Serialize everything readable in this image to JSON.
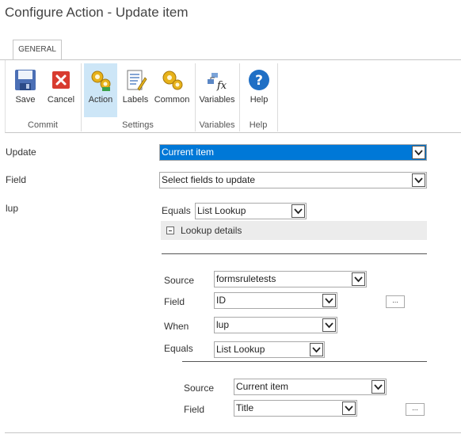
{
  "title": "Configure Action - Update item",
  "ribbon": {
    "tab": "GENERAL",
    "buttons": {
      "save": "Save",
      "cancel": "Cancel",
      "action": "Action",
      "labels": "Labels",
      "common": "Common",
      "variables": "Variables",
      "help": "Help"
    },
    "groups": {
      "commit": "Commit",
      "settings": "Settings",
      "variables": "Variables",
      "help": "Help"
    }
  },
  "form": {
    "update_label": "Update",
    "update_value": "Current item",
    "field_label": "Field",
    "field_value": "Select fields to update",
    "lup_label": "lup",
    "equals_label": "Equals",
    "equals_value": "List Lookup",
    "lookup_details": "Lookup details",
    "lookup1": {
      "source_label": "Source",
      "source_value": "formsruletests",
      "field_label": "Field",
      "field_value": "ID",
      "when_label": "When",
      "when_value": "lup",
      "equals_label": "Equals",
      "equals_value": "List Lookup",
      "ellipsis": "..."
    },
    "lookup2": {
      "source_label": "Source",
      "source_value": "Current item",
      "field_label": "Field",
      "field_value": "Title",
      "ellipsis": "..."
    }
  }
}
